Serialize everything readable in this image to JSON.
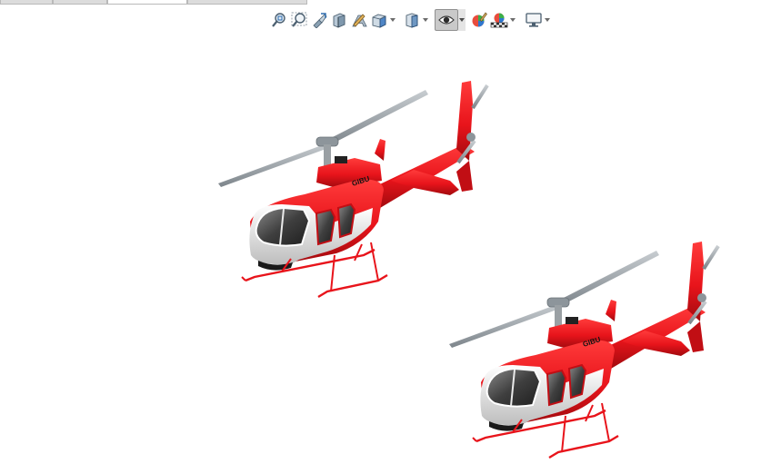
{
  "app": {
    "tabs": [
      {
        "name": "tab-1",
        "label": ""
      },
      {
        "name": "tab-2",
        "label": ""
      },
      {
        "name": "tab-3",
        "label": ""
      },
      {
        "name": "tab-4",
        "label": ""
      }
    ]
  },
  "heads_up_toolbar": {
    "buttons": [
      {
        "icon": "zoom-to-fit-icon"
      },
      {
        "icon": "zoom-to-area-icon"
      },
      {
        "icon": "previous-view-icon"
      },
      {
        "icon": "section-view-icon"
      },
      {
        "icon": "dynamic-annotation-icon"
      },
      {
        "icon": "view-orientation-icon"
      },
      {
        "icon": "display-style-icon"
      },
      {
        "icon": "hide-show-items-icon"
      },
      {
        "icon": "edit-appearance-icon"
      },
      {
        "icon": "apply-scene-icon"
      },
      {
        "icon": "view-settings-icon"
      }
    ]
  },
  "model": {
    "livery_text": "GIBU",
    "colors": {
      "body": "#e8141b",
      "window": "#4a4a4a",
      "white": "#f2f2f2",
      "rotor": "#9aa0a4"
    }
  }
}
